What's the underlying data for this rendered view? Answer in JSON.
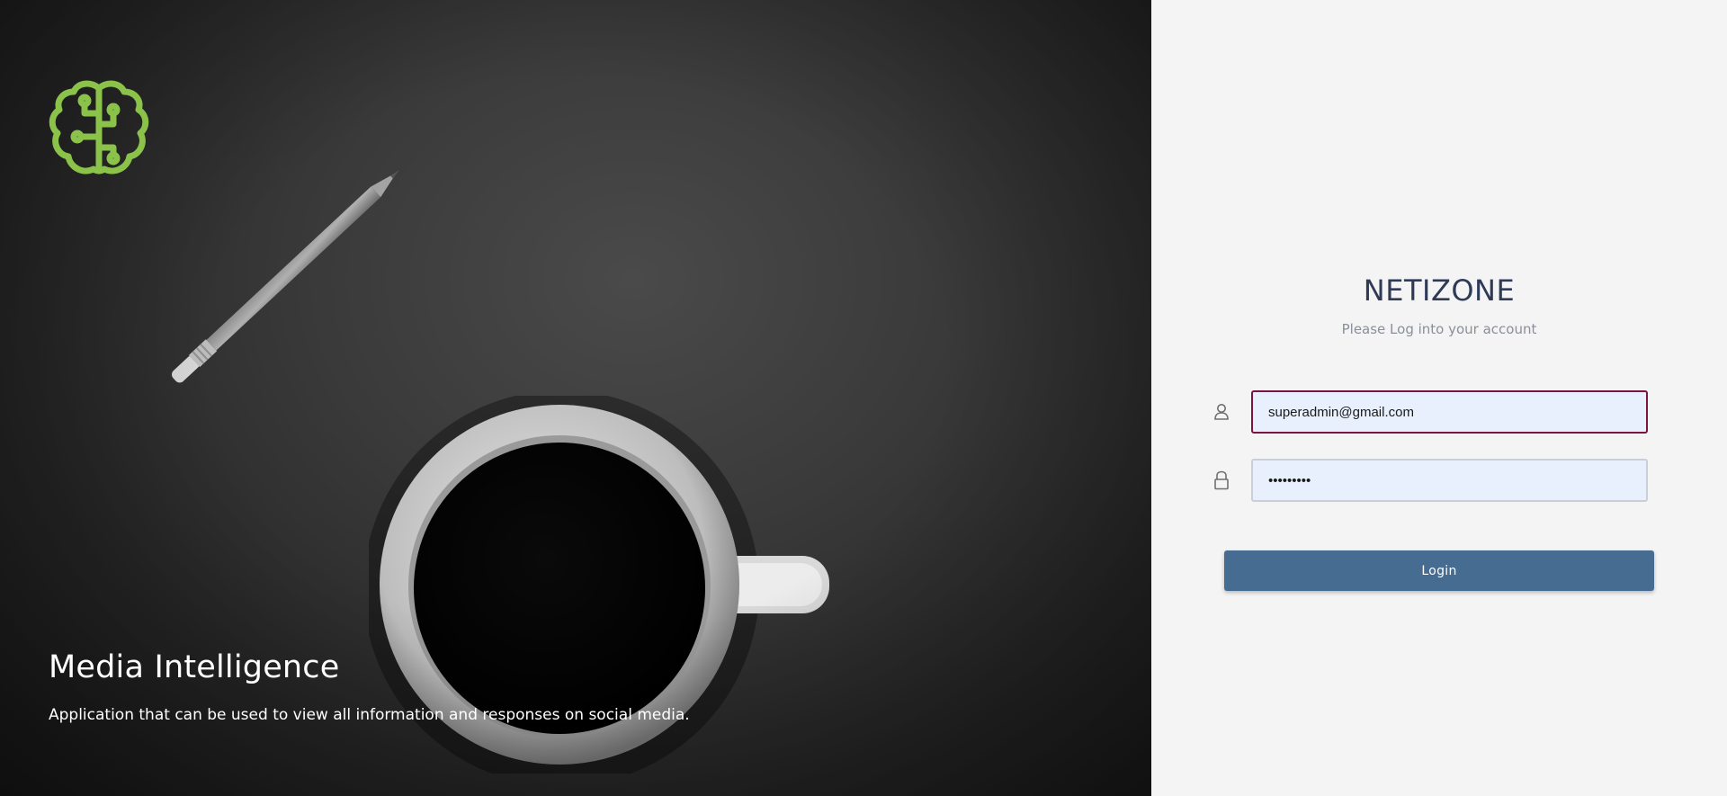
{
  "hero": {
    "logo_icon": "brain-circuit-icon",
    "logo_color": "#8bc34a",
    "title": "Media Intelligence",
    "subtitle": "Application that can be used to view all information and responses on social media."
  },
  "login": {
    "brand": "NETIZONE",
    "tagline": "Please Log into your account",
    "email": {
      "icon": "user-icon",
      "value": "superadmin@gmail.com"
    },
    "password": {
      "icon": "lock-icon",
      "value": "•••••••••"
    },
    "submit_label": "Login"
  },
  "colors": {
    "accent_button": "#476c91",
    "focus_border": "#7a1440",
    "brand_text": "#2f3a57"
  }
}
